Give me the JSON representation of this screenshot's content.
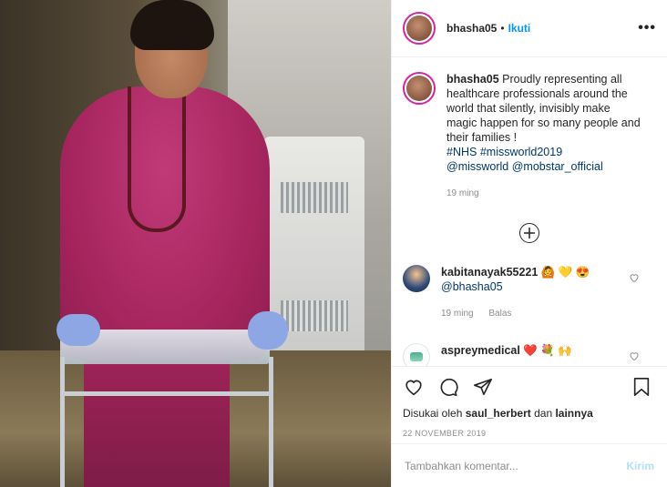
{
  "post": {
    "username": "bhasha05",
    "separator": "•",
    "follow_label": "Ikuti",
    "more_label": "•••",
    "photo_description": "",
    "caption": {
      "username": "bhasha05",
      "text": "Proudly representing all healthcare professionals around the world that silently, invisibly make magic happen for so many people and their families !",
      "hashtag1": "#NHS",
      "hashtag2": "#missworld2019",
      "mention1": "@missworld",
      "mention2": "@mobstar_official",
      "time": "19 ming"
    },
    "load_more_icon": "plus-circle-icon",
    "comments": [
      {
        "username": "kabitanayak55221",
        "emojis": "🙆 💛 😍",
        "mention": "@bhasha05",
        "time": "19 ming",
        "reply_label": "Balas"
      },
      {
        "username": "aspreymedical",
        "emojis": "❤️ 💐 🙌"
      }
    ],
    "likes": {
      "prefix": "Disukai oleh",
      "user": "saul_herbert",
      "conj": "dan",
      "others": "lainnya"
    },
    "date": "22 NOVEMBER 2019",
    "add_comment_placeholder": "Tambahkan komentar...",
    "post_label": "Kirim"
  },
  "colors": {
    "link_blue": "#0095f6",
    "mention_blue": "#00376b",
    "muted": "#8e8e8e",
    "post_disabled": "#b2dffc"
  }
}
